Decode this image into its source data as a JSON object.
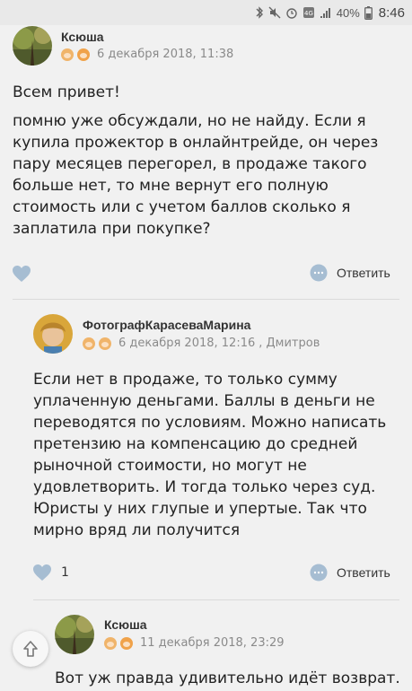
{
  "status_bar": {
    "battery_percent": "40%",
    "time": "8:46",
    "network": "4G"
  },
  "comments": [
    {
      "author": "Ксюша",
      "date": "6 декабря 2018, 11:38",
      "greeting": "Всем привет!",
      "text": "помню уже обсуждали, но не найду. Если я купила прожектор в онлайнтрейде, он через пару месяцев перегорел, в продаже такого больше нет, то мне вернут его полную стоимость или с учетом баллов сколько я заплатила при покупке?",
      "likes": "",
      "reply_label": "Ответить"
    },
    {
      "author": "ФотографКарасеваМарина",
      "date": "6 декабря 2018, 12:16",
      "location": ", Дмитров",
      "text": "Если нет в продаже, то только сумму уплаченную деньгами. Баллы в деньги не переводятся по условиям. Можно написать претензию на компенсацию до средней рыночной стоимости, но могут не удовлетворить. И тогда только через суд. Юристы у них глупые и упертые. Так что мирно вряд ли получится",
      "likes": "1",
      "reply_label": "Ответить"
    },
    {
      "author": "Ксюша",
      "date": "11 декабря 2018, 23:29",
      "text": "Вот уж правда удивительно идёт возврат."
    }
  ],
  "colors": {
    "background": "#f1f1f1",
    "icon_blue": "#9db3c9",
    "meta_gray": "#8a8a8a"
  }
}
